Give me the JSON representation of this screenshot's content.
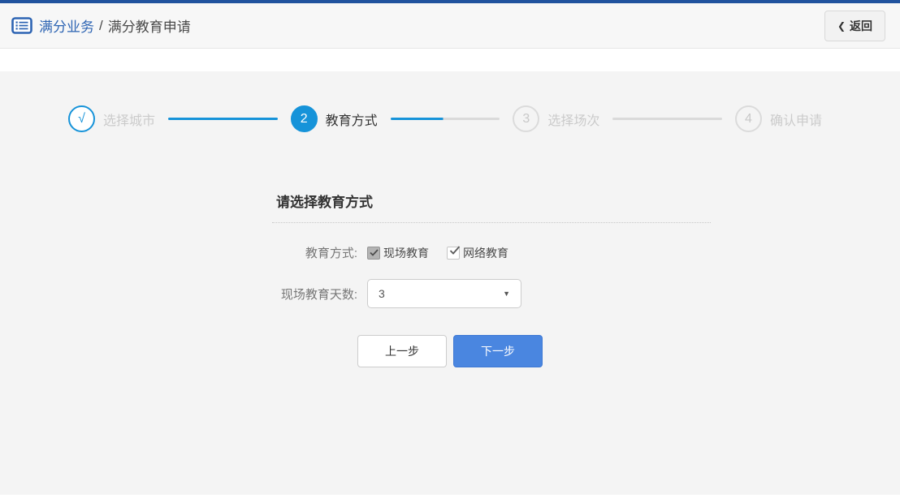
{
  "colors": {
    "top_bar_blue": "#21539e",
    "brand_blue": "#2d64b3",
    "stepper_active_blue": "#1693d9",
    "next_button_blue": "#4a86e0",
    "page_background": "#f4f4f4",
    "inactive_gray": "#cbcbcb"
  },
  "header": {
    "breadcrumb_primary": "满分业务",
    "breadcrumb_separator": "/",
    "breadcrumb_secondary": "满分教育申请",
    "back_label": "返回"
  },
  "icons": {
    "chevron_left": "❮",
    "caret_down": "▼"
  },
  "stepper": {
    "steps": [
      {
        "marker": "√",
        "label": "选择城市",
        "state": "completed"
      },
      {
        "marker": "2",
        "label": "教育方式",
        "state": "active"
      },
      {
        "marker": "3",
        "label": "选择场次",
        "state": "pending"
      },
      {
        "marker": "4",
        "label": "确认申请",
        "state": "pending"
      }
    ]
  },
  "form": {
    "title": "请选择教育方式",
    "education_mode": {
      "label": "教育方式:",
      "options": [
        {
          "label": "现场教育",
          "checked": true,
          "disabled": true
        },
        {
          "label": "网络教育",
          "checked": true,
          "disabled": false
        }
      ]
    },
    "onsite_days": {
      "label": "现场教育天数:",
      "value": "3"
    },
    "buttons": {
      "previous": "上一步",
      "next": "下一步"
    }
  }
}
